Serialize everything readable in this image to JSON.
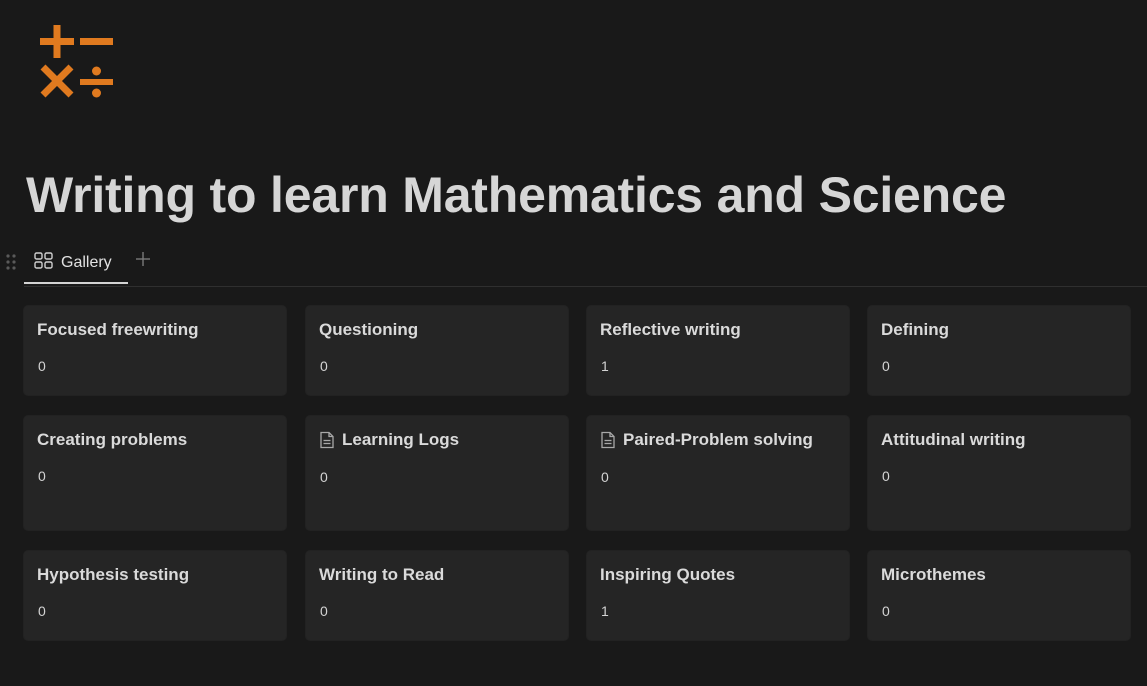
{
  "page": {
    "icon": "plus-minus-times-divide-icon",
    "icon_color": "#e07a1f",
    "title": "Writing to learn Mathematics and Science"
  },
  "tabs": {
    "active_label": "Gallery",
    "active_icon": "gallery-icon",
    "add_icon": "plus-icon"
  },
  "gallery": {
    "cards": [
      {
        "title": "Focused freewriting",
        "value": "0",
        "icon": ""
      },
      {
        "title": "Questioning",
        "value": "0",
        "icon": ""
      },
      {
        "title": "Reflective writing",
        "value": "1",
        "icon": ""
      },
      {
        "title": "Defining",
        "value": "0",
        "icon": ""
      },
      {
        "title": "Creating problems",
        "value": "0",
        "icon": ""
      },
      {
        "title": "Learning Logs",
        "value": "0",
        "icon": "document-icon"
      },
      {
        "title": "Paired-Problem solving",
        "value": "0",
        "icon": "document-icon"
      },
      {
        "title": "Attitudinal writing",
        "value": "0",
        "icon": ""
      },
      {
        "title": "Hypothesis testing",
        "value": "0",
        "icon": ""
      },
      {
        "title": "Writing to Read",
        "value": "0",
        "icon": ""
      },
      {
        "title": "Inspiring Quotes",
        "value": "1",
        "icon": ""
      },
      {
        "title": "Microthemes",
        "value": "0",
        "icon": ""
      }
    ]
  }
}
